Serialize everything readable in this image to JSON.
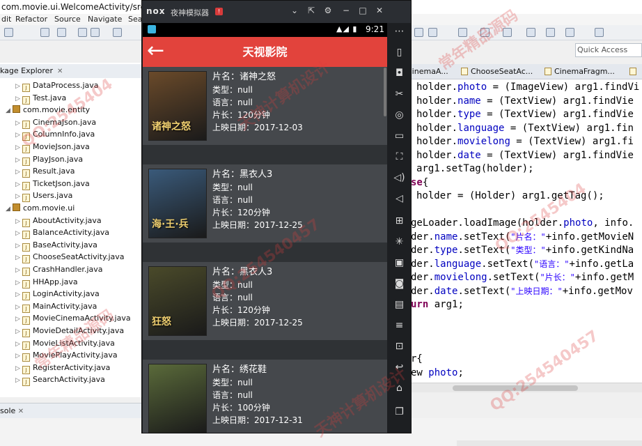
{
  "ide": {
    "title": "com.movie.ui.WelcomeActivity/src/com",
    "menu": [
      "dit",
      "Refactor",
      "Source",
      "Navigate",
      "Sea"
    ],
    "quick_access_placeholder": "Quick Access",
    "package_explorer_label": "kage Explorer",
    "console_label": "sole",
    "tree": [
      {
        "type": "file",
        "label": "DataProcess.java"
      },
      {
        "type": "file",
        "label": "Test.java"
      },
      {
        "type": "package",
        "label": "com.movie.entity"
      },
      {
        "type": "file",
        "label": "CinemaJson.java"
      },
      {
        "type": "file",
        "label": "ColumnInfo.java"
      },
      {
        "type": "file",
        "label": "MovieJson.java"
      },
      {
        "type": "file",
        "label": "PlayJson.java"
      },
      {
        "type": "file",
        "label": "Result.java"
      },
      {
        "type": "file",
        "label": "TicketJson.java"
      },
      {
        "type": "file",
        "label": "Users.java"
      },
      {
        "type": "package",
        "label": "com.movie.ui"
      },
      {
        "type": "file",
        "label": "AboutActivity.java"
      },
      {
        "type": "file",
        "label": "BalanceActivity.java"
      },
      {
        "type": "file",
        "label": "BaseActivity.java"
      },
      {
        "type": "file",
        "label": "ChooseSeatActivity.java"
      },
      {
        "type": "file",
        "label": "CrashHandler.java"
      },
      {
        "type": "file",
        "label": "HHApp.java"
      },
      {
        "type": "file",
        "label": "LoginActivity.java"
      },
      {
        "type": "file",
        "label": "MainActivity.java"
      },
      {
        "type": "file",
        "label": "MovieCinemaActivity.java"
      },
      {
        "type": "file",
        "label": "MovieDetailActivity.java"
      },
      {
        "type": "file",
        "label": "MovieListActivity.java"
      },
      {
        "type": "file",
        "label": "MoviePlayActivity.java"
      },
      {
        "type": "file",
        "label": "RegisterActivity.java"
      },
      {
        "type": "file",
        "label": "SearchActivity.java"
      }
    ],
    "editor_tabs": [
      "CinemaA...",
      "ChooseSeatAc...",
      "CinemaFragm..."
    ],
    "code_lines": [
      [
        {
          "c": "plain",
          "t": "holder."
        },
        {
          "c": "fld",
          "t": "photo"
        },
        {
          "c": "plain",
          "t": " = (ImageView) arg1.findVi"
        }
      ],
      [
        {
          "c": "plain",
          "t": "holder."
        },
        {
          "c": "fld",
          "t": "name"
        },
        {
          "c": "plain",
          "t": " = (TextView) arg1.findVie"
        }
      ],
      [
        {
          "c": "plain",
          "t": "holder."
        },
        {
          "c": "fld",
          "t": "type"
        },
        {
          "c": "plain",
          "t": " = (TextView) arg1.findVie"
        }
      ],
      [
        {
          "c": "plain",
          "t": "holder."
        },
        {
          "c": "fld",
          "t": "language"
        },
        {
          "c": "plain",
          "t": " = (TextView) arg1.fin"
        }
      ],
      [
        {
          "c": "plain",
          "t": "holder."
        },
        {
          "c": "fld",
          "t": "movielong"
        },
        {
          "c": "plain",
          "t": " = (TextView) arg1.fi"
        }
      ],
      [
        {
          "c": "plain",
          "t": "holder."
        },
        {
          "c": "fld",
          "t": "date"
        },
        {
          "c": "plain",
          "t": " = (TextView) arg1.findVie"
        }
      ],
      [
        {
          "c": "plain",
          "t": "arg1.setTag(holder);"
        }
      ],
      [
        {
          "c": "kw",
          "t": "se"
        },
        {
          "c": "plain",
          "t": "{"
        }
      ],
      [
        {
          "c": "plain",
          "t": "holder = (Holder) arg1.getTag();"
        }
      ],
      [
        {
          "c": "plain",
          "t": ""
        }
      ],
      [
        {
          "c": "plain",
          "t": "geLoader.loadImage(holder."
        },
        {
          "c": "fld",
          "t": "photo"
        },
        {
          "c": "plain",
          "t": ", info."
        }
      ],
      [
        {
          "c": "plain",
          "t": "der."
        },
        {
          "c": "fld",
          "t": "name"
        },
        {
          "c": "plain",
          "t": ".setText("
        },
        {
          "c": "str",
          "t": "\"片名：\""
        },
        {
          "c": "plain",
          "t": "+info.getMovieN"
        }
      ],
      [
        {
          "c": "plain",
          "t": "der."
        },
        {
          "c": "fld",
          "t": "type"
        },
        {
          "c": "plain",
          "t": ".setText("
        },
        {
          "c": "str",
          "t": "\"类型：\""
        },
        {
          "c": "plain",
          "t": "+info.getKindNa"
        }
      ],
      [
        {
          "c": "plain",
          "t": "der."
        },
        {
          "c": "fld",
          "t": "language"
        },
        {
          "c": "plain",
          "t": ".setText("
        },
        {
          "c": "str",
          "t": "\"语言：\""
        },
        {
          "c": "plain",
          "t": "+info.getLa"
        }
      ],
      [
        {
          "c": "plain",
          "t": "der."
        },
        {
          "c": "fld",
          "t": "movielong"
        },
        {
          "c": "plain",
          "t": ".setText("
        },
        {
          "c": "str",
          "t": "\"片长：\""
        },
        {
          "c": "plain",
          "t": "+info.getM"
        }
      ],
      [
        {
          "c": "plain",
          "t": "der."
        },
        {
          "c": "fld",
          "t": "date"
        },
        {
          "c": "plain",
          "t": ".setText("
        },
        {
          "c": "str",
          "t": "\"上映日期：\""
        },
        {
          "c": "plain",
          "t": "+info.getMov"
        }
      ],
      [
        {
          "c": "kw",
          "t": "urn"
        },
        {
          "c": "plain",
          "t": " arg1;"
        }
      ],
      [
        {
          "c": "plain",
          "t": ""
        }
      ],
      [
        {
          "c": "plain",
          "t": ""
        }
      ],
      [
        {
          "c": "plain",
          "t": ""
        }
      ],
      [
        {
          "c": "plain",
          "t": "r{"
        }
      ],
      [
        {
          "c": "plain",
          "t": "ew "
        },
        {
          "c": "fld",
          "t": "photo"
        },
        {
          "c": "plain",
          "t": ";"
        }
      ]
    ]
  },
  "emulator": {
    "logo": "nox",
    "name": "夜神模拟器",
    "badge": "!",
    "time": "9:21",
    "signal": "▲◢ ▮"
  },
  "app": {
    "title": "天视影院",
    "movies": [
      {
        "name": "片名：诸神之怒",
        "type": "类型：null",
        "language": "语言：null",
        "length": "片长：120分钟",
        "date": "上映日期：2017-12-03",
        "poster_text": "诸神之怒",
        "poster_color": "#6a4a2a"
      },
      {
        "name": "片名：黑衣人3",
        "type": "类型：null",
        "language": "语言：null",
        "length": "片长：120分钟",
        "date": "上映日期：2017-12-25",
        "poster_text": "海·王·兵",
        "poster_color": "#3a5a7a"
      },
      {
        "name": "片名：黑衣人3",
        "type": "类型：null",
        "language": "语言：null",
        "length": "片长：120分钟",
        "date": "上映日期：2017-12-25",
        "poster_text": "狂怒",
        "poster_color": "#4a4a2a"
      },
      {
        "name": "片名：绣花鞋",
        "type": "类型：null",
        "language": "语言：null",
        "length": "片长：100分钟",
        "date": "上映日期：2017-12-31",
        "poster_text": "",
        "poster_color": "#5a6a3a"
      }
    ]
  },
  "watermarks": [
    "QQ:2545404",
    "天神计算机设计",
    "常年精品源码",
    "QQ:254540457"
  ],
  "colors": {
    "appbar": "#e2433c",
    "list_bg": "#45484c",
    "divider": "#2f3235"
  }
}
